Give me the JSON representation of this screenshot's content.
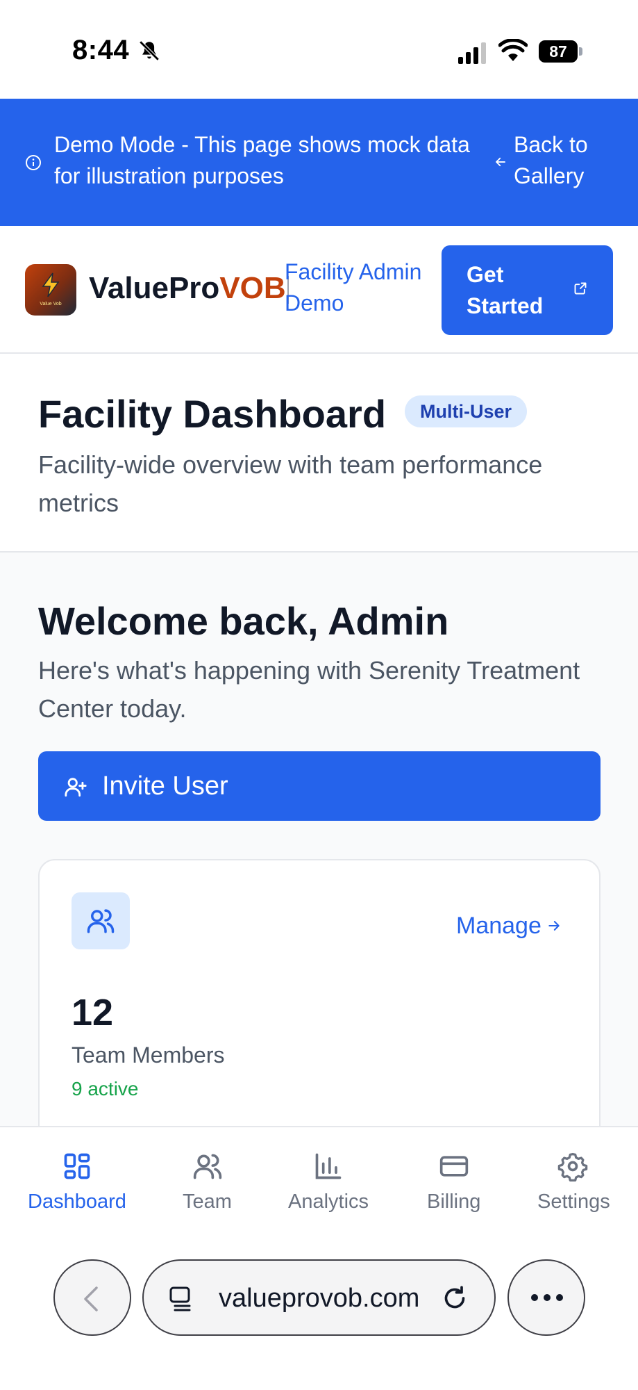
{
  "status_bar": {
    "time": "8:44",
    "battery": "87"
  },
  "demo_banner": {
    "text": "Demo Mode - This page shows mock data for illustration purposes",
    "back_label": "Back to Gallery"
  },
  "header": {
    "brand_part1": "ValuePro",
    "brand_part2": "VOB",
    "logo_small_text": "Value Vob",
    "subtitle": "Facility Admin Demo",
    "cta_label": "Get Started"
  },
  "page": {
    "title": "Facility Dashboard",
    "badge": "Multi-User",
    "subtitle": "Facility-wide overview with team performance metrics"
  },
  "welcome": {
    "title": "Welcome back, Admin",
    "subtitle": "Here's what's happening with Serenity Treatment Center today.",
    "invite_label": "Invite User"
  },
  "stat_card": {
    "value": "12",
    "label": "Team Members",
    "sub": "9 active",
    "link_label": "Manage"
  },
  "bottom_nav": {
    "items": [
      {
        "label": "Dashboard",
        "icon": "dashboard-icon",
        "active": true
      },
      {
        "label": "Team",
        "icon": "users-icon",
        "active": false
      },
      {
        "label": "Analytics",
        "icon": "bar-chart-icon",
        "active": false
      },
      {
        "label": "Billing",
        "icon": "credit-card-icon",
        "active": false
      },
      {
        "label": "Settings",
        "icon": "gear-icon",
        "active": false
      }
    ]
  },
  "browser": {
    "url": "valueprovob.com"
  },
  "colors": {
    "primary": "#2563eb",
    "brand_accent": "#c2410c",
    "success": "#16a34a",
    "badge_bg": "#dbeafe"
  }
}
